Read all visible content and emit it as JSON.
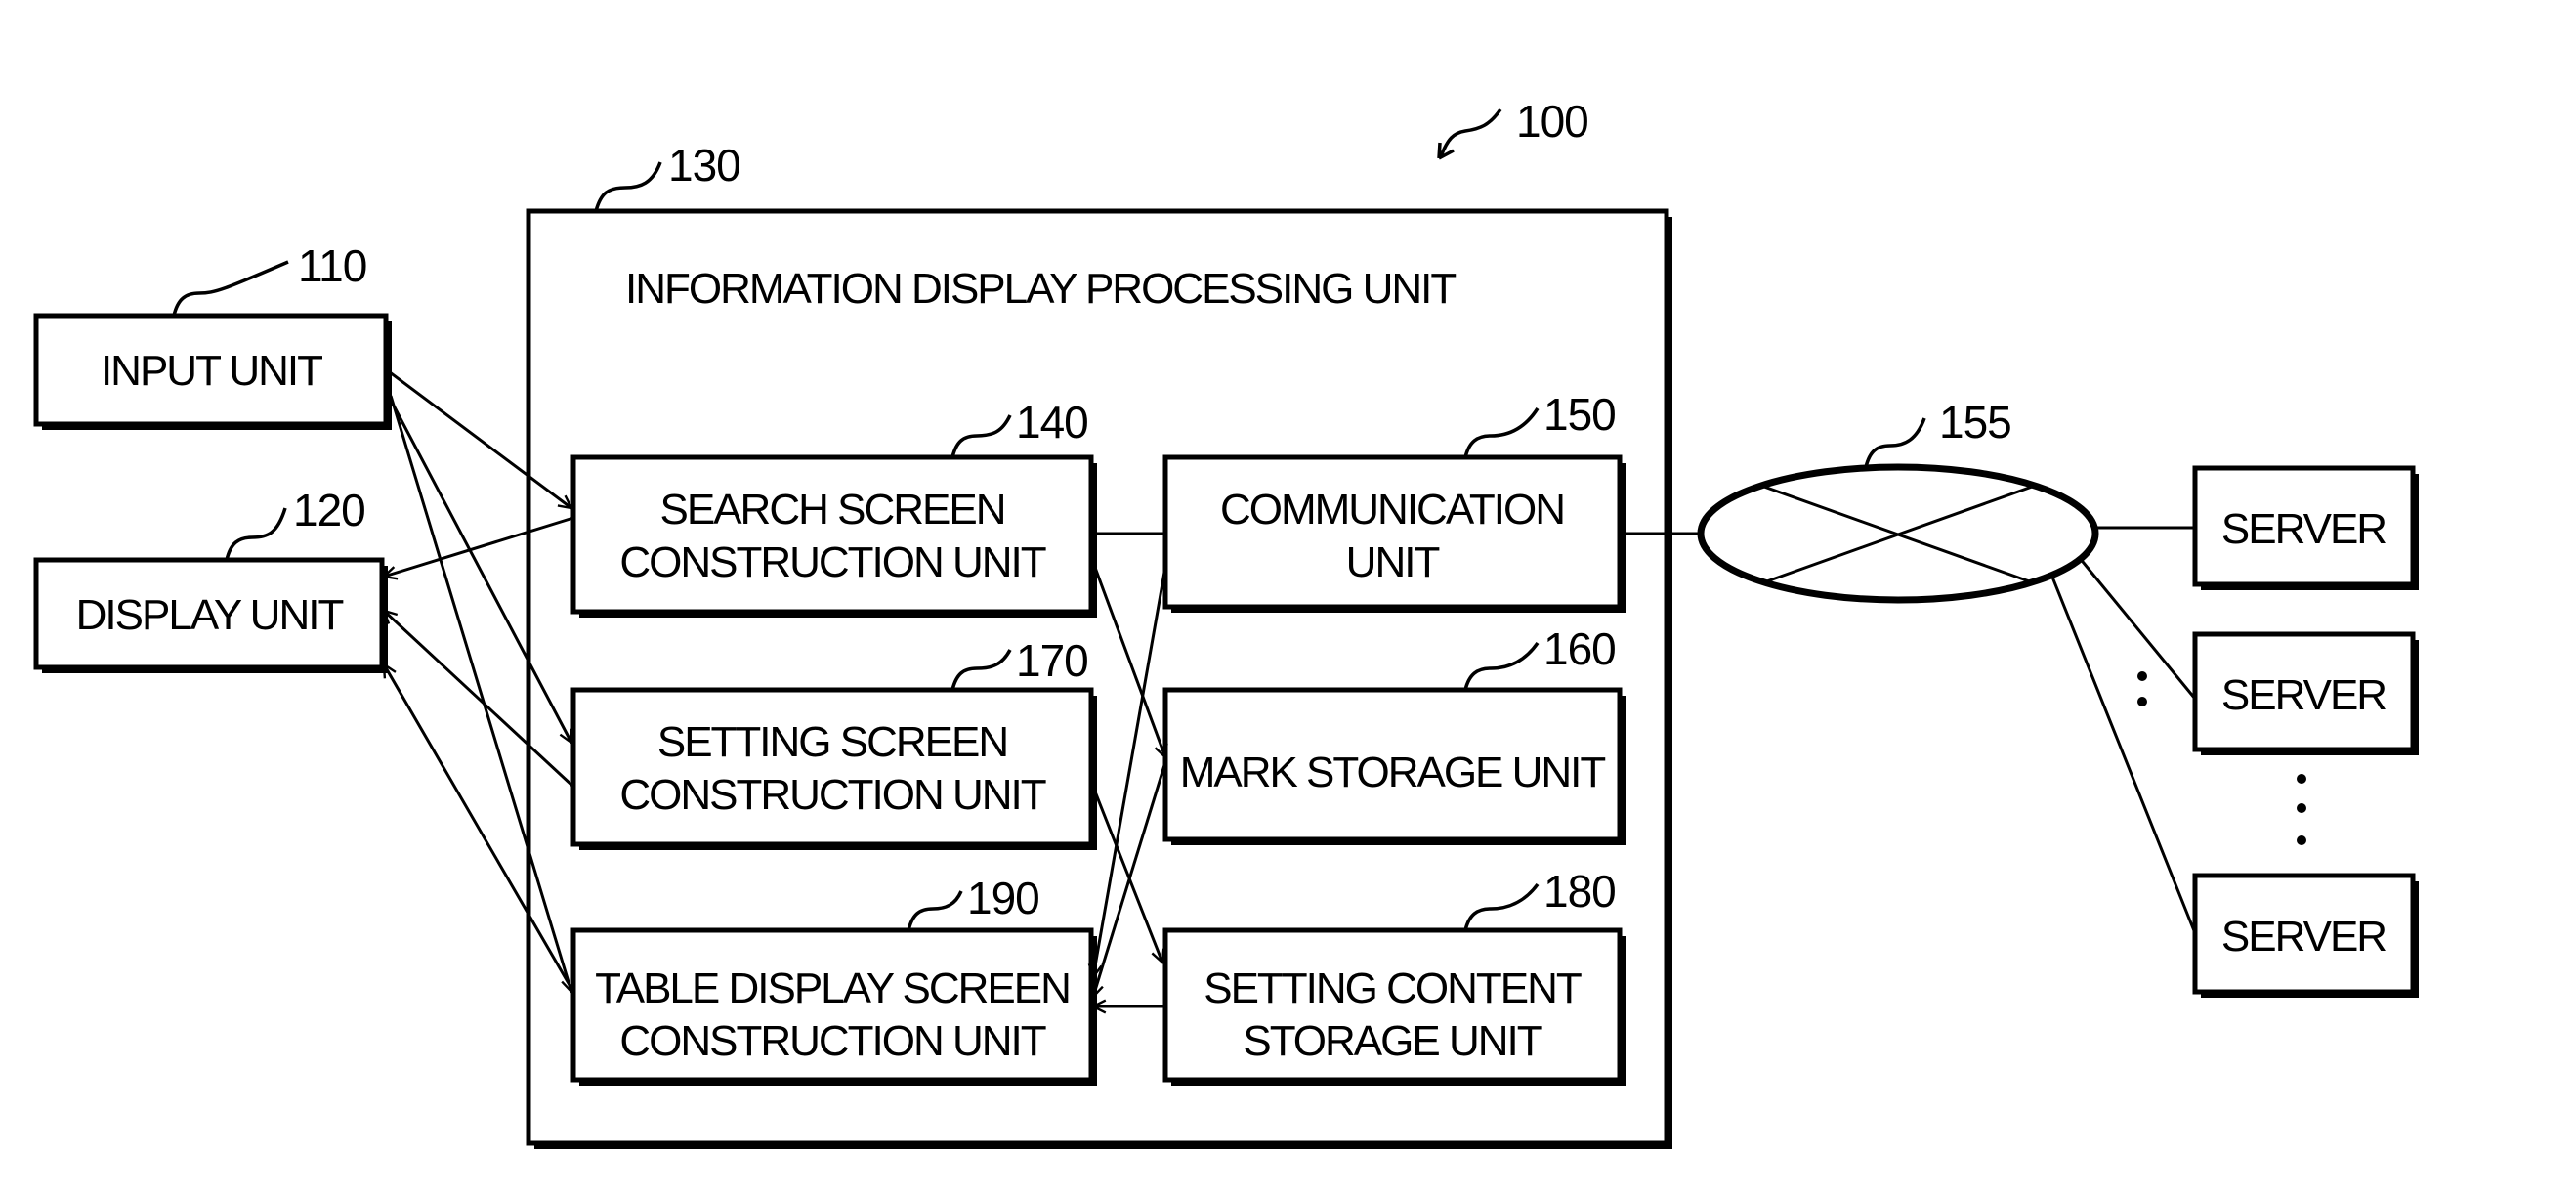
{
  "figure": {
    "system_ref": "100",
    "container": {
      "ref": "130",
      "title": "INFORMATION DISPLAY PROCESSING UNIT"
    },
    "external": {
      "input": {
        "ref": "110",
        "label": "INPUT UNIT"
      },
      "display": {
        "ref": "120",
        "label": "DISPLAY UNIT"
      }
    },
    "units": {
      "search": {
        "ref": "140",
        "line1": "SEARCH SCREEN",
        "line2": "CONSTRUCTION UNIT"
      },
      "communication": {
        "ref": "150",
        "line1": "COMMUNICATION",
        "line2": "UNIT"
      },
      "setting": {
        "ref": "170",
        "line1": "SETTING SCREEN",
        "line2": "CONSTRUCTION UNIT"
      },
      "mark": {
        "ref": "160",
        "line1": "MARK STORAGE UNIT"
      },
      "table": {
        "ref": "190",
        "line1": "TABLE DISPLAY SCREEN",
        "line2": "CONSTRUCTION UNIT"
      },
      "setting_content": {
        "ref": "180",
        "line1": "SETTING CONTENT",
        "line2": "STORAGE UNIT"
      }
    },
    "network": {
      "ref": "155"
    },
    "servers": [
      {
        "label": "SERVER"
      },
      {
        "label": "SERVER"
      },
      {
        "label": "SERVER"
      }
    ],
    "connections": [
      {
        "from": "INPUT UNIT",
        "to": "SEARCH SCREEN CONSTRUCTION UNIT"
      },
      {
        "from": "INPUT UNIT",
        "to": "SETTING SCREEN CONSTRUCTION UNIT"
      },
      {
        "from": "INPUT UNIT",
        "to": "TABLE DISPLAY SCREEN CONSTRUCTION UNIT"
      },
      {
        "from": "SEARCH SCREEN CONSTRUCTION UNIT",
        "to": "DISPLAY UNIT"
      },
      {
        "from": "SETTING SCREEN CONSTRUCTION UNIT",
        "to": "DISPLAY UNIT"
      },
      {
        "from": "TABLE DISPLAY SCREEN CONSTRUCTION UNIT",
        "to": "DISPLAY UNIT"
      },
      {
        "from": "SEARCH SCREEN CONSTRUCTION UNIT",
        "to": "COMMUNICATION UNIT"
      },
      {
        "from": "SEARCH SCREEN CONSTRUCTION UNIT",
        "to": "MARK STORAGE UNIT"
      },
      {
        "from": "COMMUNICATION UNIT",
        "to": "TABLE DISPLAY SCREEN CONSTRUCTION UNIT"
      },
      {
        "from": "MARK STORAGE UNIT",
        "to": "TABLE DISPLAY SCREEN CONSTRUCTION UNIT"
      },
      {
        "from": "SETTING SCREEN CONSTRUCTION UNIT",
        "to": "SETTING CONTENT STORAGE UNIT"
      },
      {
        "from": "SETTING CONTENT STORAGE UNIT",
        "to": "TABLE DISPLAY SCREEN CONSTRUCTION UNIT"
      },
      {
        "from": "COMMUNICATION UNIT",
        "to": "NETWORK"
      },
      {
        "from": "NETWORK",
        "to": "SERVER"
      }
    ]
  }
}
